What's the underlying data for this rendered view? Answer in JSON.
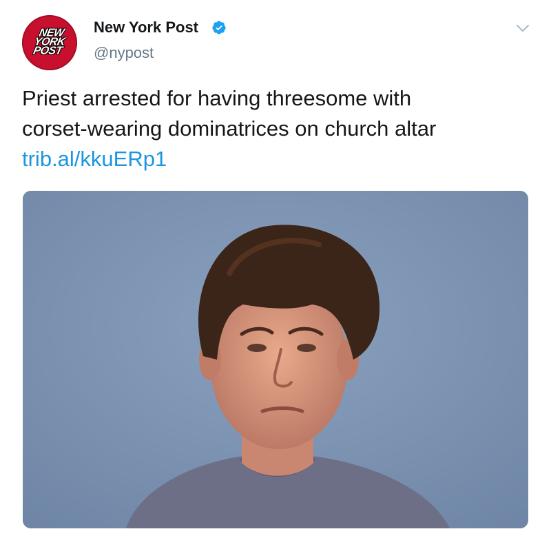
{
  "account": {
    "avatar_logo_lines": [
      "NEW",
      "YORK",
      "POST"
    ],
    "display_name": "New York Post",
    "handle": "@nypost",
    "verified": true
  },
  "tweet": {
    "text_line_1": "Priest arrested for having threesome with",
    "text_line_2": "corset-wearing dominatrices on church altar",
    "link": "trib.al/kkuERp1"
  },
  "media": {
    "description_icon": "photo",
    "background_color": "#7d93b1"
  },
  "colors": {
    "brand_red": "#c8102e",
    "link_blue": "#1b95e0",
    "verified_blue": "#1da1f2",
    "muted_gray": "#657786",
    "text": "#14171a"
  },
  "icons": {
    "verified": "verified-badge-icon",
    "more": "chevron-down-icon"
  }
}
